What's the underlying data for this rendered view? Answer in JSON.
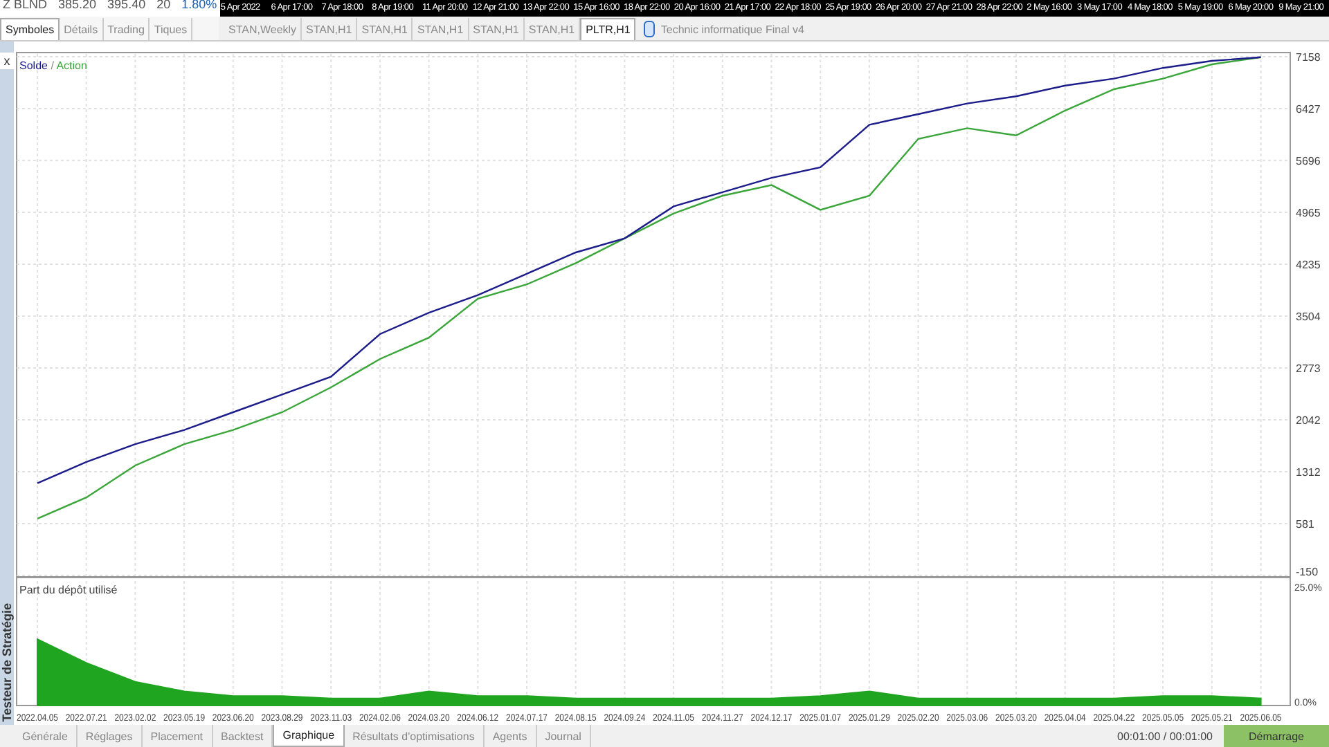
{
  "market_watch": {
    "symbol": "Z BLND",
    "bid": "385.20",
    "ask": "395.40",
    "spread": "20",
    "change": "1.80%"
  },
  "time_axis": [
    "5 Apr 2022",
    "6 Apr 17:00",
    "7 Apr 18:00",
    "8 Apr 19:00",
    "11 Apr 20:00",
    "12 Apr 21:00",
    "13 Apr 22:00",
    "15 Apr 16:00",
    "18 Apr 22:00",
    "20 Apr 16:00",
    "21 Apr 17:00",
    "22 Apr 18:00",
    "25 Apr 19:00",
    "26 Apr 20:00",
    "27 Apr 21:00",
    "28 Apr 22:00",
    "2 May 16:00",
    "3 May 17:00",
    "4 May 18:00",
    "5 May 19:00",
    "6 May 20:00",
    "9 May 21:00"
  ],
  "panel_tabs": [
    {
      "label": "Symboles",
      "selected": true
    },
    {
      "label": "Détails",
      "selected": false
    },
    {
      "label": "Trading",
      "selected": false
    },
    {
      "label": "Tiques",
      "selected": false
    }
  ],
  "chart_tabs": [
    {
      "label": "STAN,Weekly",
      "selected": false
    },
    {
      "label": "STAN,H1",
      "selected": false
    },
    {
      "label": "STAN,H1",
      "selected": false
    },
    {
      "label": "STAN,H1",
      "selected": false
    },
    {
      "label": "STAN,H1",
      "selected": false
    },
    {
      "label": "STAN,H1",
      "selected": false
    },
    {
      "label": "PLTR,H1",
      "selected": true
    }
  ],
  "expert": {
    "name": "Technic informatique Final v4"
  },
  "side_panel": {
    "title": "Testeur de Stratégie",
    "close": "x"
  },
  "balance_chart": {
    "legend_separator": "/",
    "chart_data": {
      "type": "line",
      "grid": true,
      "ylim": [
        -150,
        7158
      ],
      "series": [
        {
          "name": "Solde",
          "color": "#1c1c8a",
          "values": [
            1150,
            1450,
            1700,
            1900,
            2150,
            2400,
            2650,
            3250,
            3550,
            3800,
            4100,
            4400,
            4600,
            5050,
            5250,
            5450,
            5600,
            6200,
            6350,
            6500,
            6600,
            6750,
            6850,
            7000,
            7100,
            7150
          ]
        },
        {
          "name": "Action",
          "color": "#3aa63a",
          "values": [
            650,
            950,
            1400,
            1700,
            1900,
            2150,
            2500,
            2900,
            3200,
            3750,
            3950,
            4250,
            4600,
            4950,
            5200,
            5350,
            5000,
            5200,
            6000,
            6150,
            6050,
            6400,
            6700,
            6850,
            7050,
            7150
          ]
        }
      ],
      "yticks": [
        7158,
        6427,
        5696,
        4965,
        4235,
        3504,
        2773,
        2042,
        1312,
        581,
        -150
      ]
    }
  },
  "deposit_chart": {
    "chart_data": {
      "type": "area",
      "grid": true,
      "ylim": [
        0,
        27
      ],
      "categories": [
        "2022.04.05",
        "2022.07.21",
        "2023.02.02",
        "2023.05.19",
        "2023.06.20",
        "2023.08.29",
        "2023.11.03",
        "2024.02.06",
        "2024.03.20",
        "2024.06.12",
        "2024.07.17",
        "2024.08.15",
        "2024.09.24",
        "2024.11.05",
        "2024.11.27",
        "2024.12.17",
        "2025.01.07",
        "2025.01.29",
        "2025.02.20",
        "2025.03.06",
        "2025.03.20",
        "2025.04.04",
        "2025.04.22",
        "2025.05.05",
        "2025.05.21",
        "2025.06.05"
      ],
      "series": [
        {
          "name": "Part du dépôt utilisé",
          "color": "#1fa51f",
          "values": [
            14,
            9,
            5,
            3,
            2,
            2,
            1.5,
            1.5,
            3,
            2,
            2,
            1.5,
            1.5,
            1.5,
            1.5,
            1.5,
            2,
            3,
            1.5,
            1.5,
            1.5,
            1.5,
            1.5,
            2,
            2,
            1.5
          ]
        }
      ],
      "yticks": [
        {
          "value": 25,
          "label": "25.0%"
        },
        {
          "value": 0,
          "label": "0.0%"
        }
      ]
    }
  },
  "bottom_tabs": [
    {
      "label": "Générale",
      "selected": false
    },
    {
      "label": "Réglages",
      "selected": false
    },
    {
      "label": "Placement",
      "selected": false
    },
    {
      "label": "Backtest",
      "selected": false
    },
    {
      "label": "Graphique",
      "selected": true
    },
    {
      "label": "Résultats d'optimisations",
      "selected": false
    },
    {
      "label": "Agents",
      "selected": false
    },
    {
      "label": "Journal",
      "selected": false
    }
  ],
  "timer": "00:01:00 / 00:01:00",
  "start_button": "Démarrage"
}
